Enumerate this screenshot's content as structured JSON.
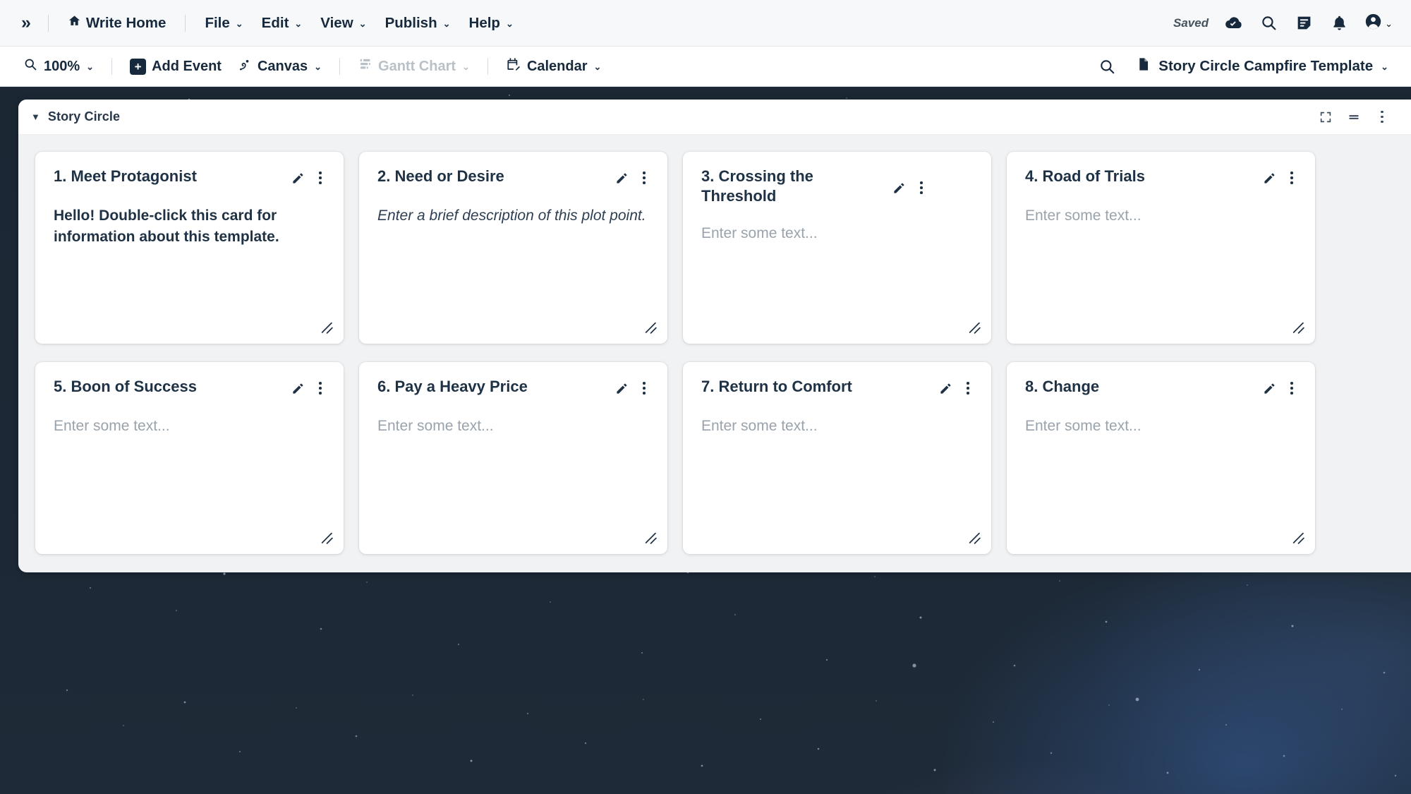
{
  "menubar": {
    "expand_icon": "chevron-double-right-icon",
    "home": {
      "label": "Write Home",
      "icon": "home-icon"
    },
    "menus": [
      {
        "label": "File"
      },
      {
        "label": "Edit"
      },
      {
        "label": "View"
      },
      {
        "label": "Publish"
      },
      {
        "label": "Help"
      }
    ],
    "status": {
      "label": "Saved",
      "icon": "cloud-check-icon"
    },
    "right_icons": [
      {
        "name": "search-icon"
      },
      {
        "name": "notes-icon"
      },
      {
        "name": "bell-icon"
      },
      {
        "name": "account-icon"
      }
    ]
  },
  "toolbar": {
    "zoom": {
      "label": "100%",
      "icon": "zoom-icon"
    },
    "add_event": {
      "label": "Add Event",
      "icon": "plus-square-icon"
    },
    "canvas": {
      "label": "Canvas",
      "icon": "canvas-icon"
    },
    "gantt": {
      "label": "Gantt Chart",
      "icon": "gantt-icon",
      "disabled": true
    },
    "calendar": {
      "label": "Calendar",
      "icon": "calendar-edit-icon"
    },
    "search_icon": "search-icon",
    "document": {
      "label": "Story Circle Campfire Template",
      "icon": "document-icon"
    }
  },
  "panel": {
    "title": "Story Circle",
    "caret": "▼",
    "actions": [
      {
        "name": "expand-icon"
      },
      {
        "name": "layout-rows-icon"
      },
      {
        "name": "more-options-icon"
      }
    ]
  },
  "placeholder_text": "Enter some text...",
  "cards": [
    {
      "title": "1. Meet Protagonist",
      "body": "Hello! Double-click this card for information about this template.",
      "body_style": "filled"
    },
    {
      "title": "2. Need or Desire",
      "body": "Enter a brief description of this plot point.",
      "body_style": "italic"
    },
    {
      "title": "3. Crossing the Threshold",
      "body": "Enter some text...",
      "body_style": "placeholder"
    },
    {
      "title": "4. Road of Trials",
      "body": "Enter some text...",
      "body_style": "placeholder"
    },
    {
      "title": "5. Boon of Success",
      "body": "Enter some text...",
      "body_style": "placeholder"
    },
    {
      "title": "6. Pay a Heavy Price",
      "body": "Enter some text...",
      "body_style": "placeholder"
    },
    {
      "title": "7. Return to Comfort",
      "body": "Enter some text...",
      "body_style": "placeholder"
    },
    {
      "title": "8. Change",
      "body": "Enter some text...",
      "body_style": "placeholder"
    }
  ],
  "colors": {
    "accent_dark": "#17293c",
    "panel_bg": "#f1f2f3",
    "canvas_top": "#1b2733",
    "placeholder": "#9aa3ab"
  }
}
